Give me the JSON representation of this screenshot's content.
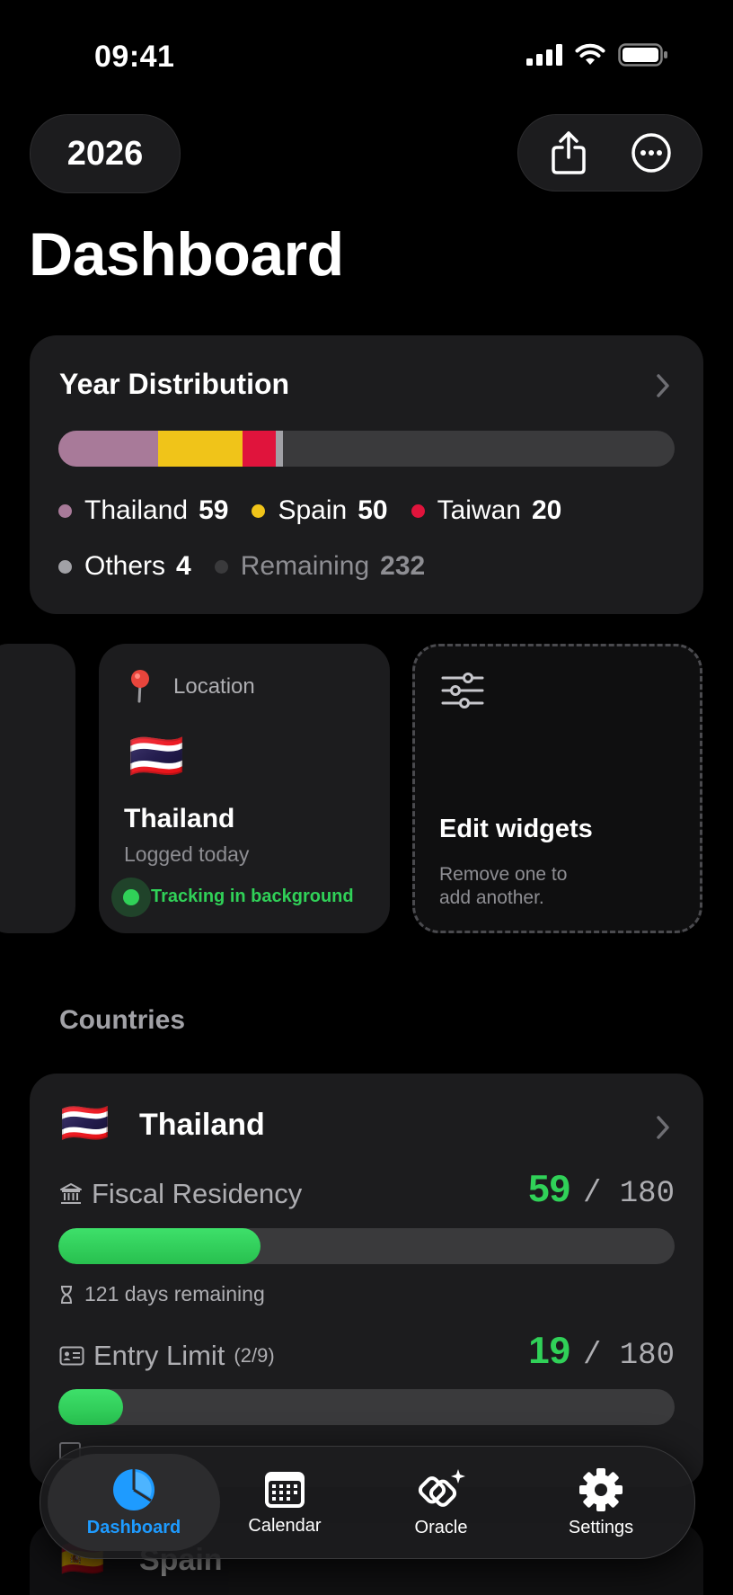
{
  "status": {
    "time": "09:41"
  },
  "header": {
    "year": "2026",
    "title": "Dashboard"
  },
  "distribution": {
    "title": "Year Distribution",
    "total_days": 365,
    "segments": [
      {
        "name": "Thailand",
        "value": 59,
        "color": "#a87a99"
      },
      {
        "name": "Spain",
        "value": 50,
        "color": "#f0c419"
      },
      {
        "name": "Taiwan",
        "value": 20,
        "color": "#e0143c"
      },
      {
        "name": "Others",
        "value": 4,
        "color": "#a1a1a6"
      },
      {
        "name": "Remaining",
        "value": 232,
        "color": "#3a3a3c"
      }
    ],
    "legend": [
      {
        "name": "Thailand",
        "value": "59",
        "color": "#a87a99"
      },
      {
        "name": "Spain",
        "value": "50",
        "color": "#f0c419"
      },
      {
        "name": "Taiwan",
        "value": "20",
        "color": "#e0143c"
      },
      {
        "name": "Others",
        "value": "4",
        "color": "#a1a1a6"
      },
      {
        "name": "Remaining",
        "value": "232",
        "color": "#3a3a3c"
      }
    ]
  },
  "location_widget": {
    "header": "Location",
    "flag": "🇹🇭",
    "country": "Thailand",
    "subtitle": "Logged today",
    "status": "Tracking in background",
    "status_color": "#30d158"
  },
  "edit_widget": {
    "title": "Edit widgets",
    "line1": "Remove one to",
    "line2": "add another."
  },
  "countries": {
    "section_label": "Countries",
    "items": [
      {
        "flag": "🇹🇭",
        "name": "Thailand",
        "fiscal": {
          "label": "Fiscal Residency",
          "value": "59",
          "limit": "/ 180",
          "progress": 0.328,
          "remaining": "121 days remaining"
        },
        "entry": {
          "label": "Entry Limit",
          "count": "(2/9)",
          "value": "19",
          "limit": "/ 180",
          "progress": 0.105
        }
      },
      {
        "flag": "🇪🇸",
        "name": "Spain"
      }
    ]
  },
  "tabs": [
    {
      "label": "Dashboard",
      "icon": "pie-chart-icon",
      "active": true
    },
    {
      "label": "Calendar",
      "icon": "calendar-icon",
      "active": false
    },
    {
      "label": "Oracle",
      "icon": "oracle-sparkle-icon",
      "active": false
    },
    {
      "label": "Settings",
      "icon": "gear-icon",
      "active": false
    }
  ]
}
